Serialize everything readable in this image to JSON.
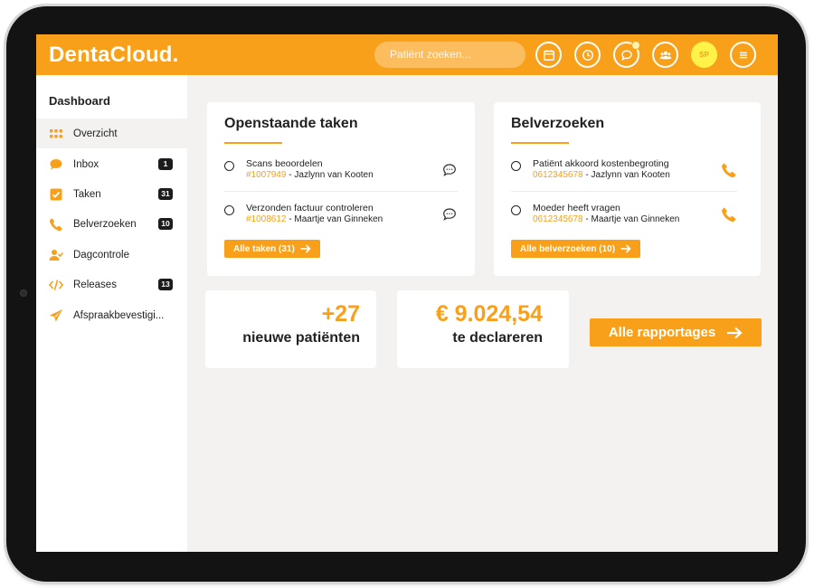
{
  "header": {
    "logo": "DentaCloud.",
    "search_placeholder": "Patiënt zoeken...",
    "avatar_initials": "SP",
    "icons": [
      "calendar-icon",
      "clock-icon",
      "chat-icon",
      "team-icon",
      "menu-icon"
    ]
  },
  "sidebar": {
    "title": "Dashboard",
    "items": [
      {
        "label": "Overzicht",
        "icon": "grid-icon",
        "badge": ""
      },
      {
        "label": "Inbox",
        "icon": "chat-bubble-icon",
        "badge": "1"
      },
      {
        "label": "Taken",
        "icon": "checkbox-icon",
        "badge": "31"
      },
      {
        "label": "Belverzoeken",
        "icon": "phone-icon",
        "badge": "10"
      },
      {
        "label": "Dagcontrole",
        "icon": "user-check-icon",
        "badge": ""
      },
      {
        "label": "Releases",
        "icon": "code-icon",
        "badge": "13"
      },
      {
        "label": "Afspraakbevestigi...",
        "icon": "paper-plane-icon",
        "badge": ""
      }
    ]
  },
  "tasks_card": {
    "title": "Openstaande taken",
    "items": [
      {
        "title": "Scans beoordelen",
        "ref": "#1007949",
        "person": " - Jazlynn van Kooten"
      },
      {
        "title": "Verzonden factuur controleren",
        "ref": "#1008612",
        "person": " - Maartje van Ginneken"
      }
    ],
    "button": "Alle taken (31)"
  },
  "calls_card": {
    "title": "Belverzoeken",
    "items": [
      {
        "title": "Patiënt akkoord kostenbegroting",
        "ref": "0612345678",
        "person": " - Jazlynn van Kooten"
      },
      {
        "title": "Moeder heeft vragen",
        "ref": "0612345678",
        "person": " - Maartje van Ginneken"
      }
    ],
    "button": "Alle belverzoeken (10)"
  },
  "stats": {
    "new_patients_value": "+27",
    "new_patients_label": "nieuwe patiënten",
    "declare_value": "€ 9.024,54",
    "declare_label": "te declareren"
  },
  "reports_button": "Alle rapportages",
  "colors": {
    "accent": "#f9a01b",
    "background": "#f3f2f1",
    "avatar": "#fff34a",
    "badge": "#1c1c1c"
  }
}
